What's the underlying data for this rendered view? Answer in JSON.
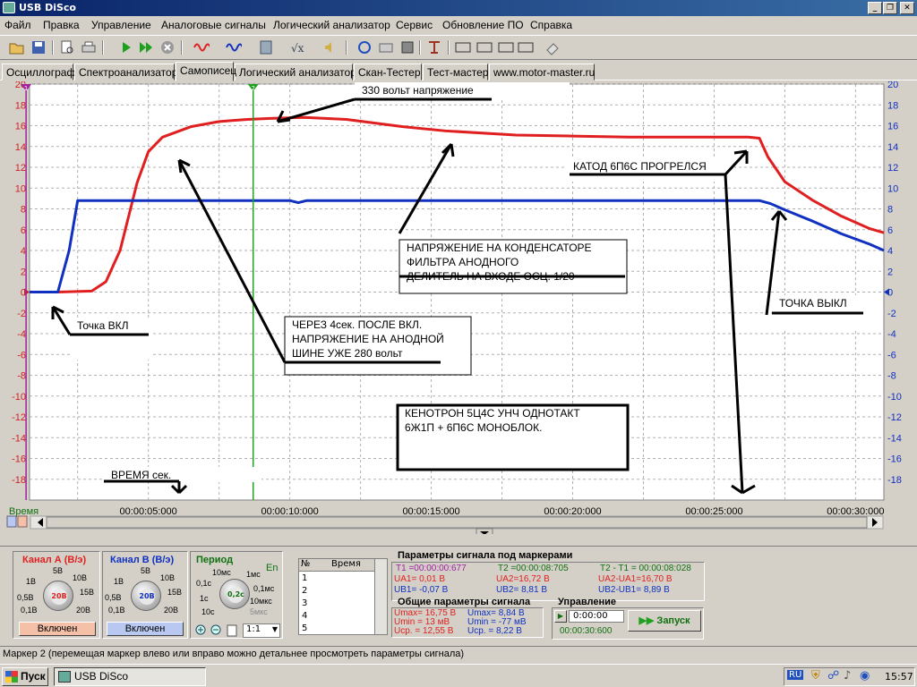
{
  "window": {
    "title": "USB DiSco"
  },
  "menu": [
    "Файл",
    "Правка",
    "Управление",
    "Аналоговые сигналы",
    "Логический анализатор",
    "Сервис",
    "Обновление ПО",
    "Справка"
  ],
  "tabs": [
    "Осциллограф",
    "Спектроанализатор",
    "Самописец",
    "Логический анализатор",
    "Скан-Тестер",
    "Тест-мастер",
    "www.motor-master.ru"
  ],
  "active_tab": "Самописец",
  "chart_data": {
    "type": "line",
    "xlabel": "Время",
    "x_ticks": [
      "00:00:05:000",
      "00:00:10:000",
      "00:00:15:000",
      "00:00:20:000",
      "00:00:25:000",
      "00:00:30:000"
    ],
    "x_tick_seconds": [
      5,
      10,
      15,
      20,
      25,
      30
    ],
    "xlim": [
      0.8,
      31
    ],
    "ylim": [
      -20,
      20
    ],
    "y_ticks": [
      20,
      18,
      16,
      14,
      12,
      10,
      8,
      6,
      4,
      2,
      0,
      -2,
      -4,
      -6,
      -8,
      -10,
      -12,
      -14,
      -16,
      -18
    ],
    "grid": true,
    "series": [
      {
        "color": "#e02020",
        "x": [
          0.8,
          1.8,
          3.0,
          3.5,
          4.0,
          4.6,
          5.0,
          5.5,
          6.5,
          7.5,
          8.5,
          9.3,
          10.5,
          12.0,
          14.0,
          15.5,
          18.0,
          20.0,
          22.0,
          24.0,
          25.0,
          26.2,
          26.6,
          26.9,
          27.5,
          28.5,
          29.5,
          30.5,
          31.0
        ],
        "y": [
          0,
          0,
          0.1,
          1.0,
          4.0,
          10.5,
          13.5,
          14.9,
          15.9,
          16.4,
          16.6,
          16.7,
          16.8,
          16.6,
          15.9,
          15.5,
          15.1,
          15.0,
          14.9,
          14.9,
          14.9,
          14.9,
          14.8,
          13.0,
          10.6,
          8.8,
          7.3,
          6.1,
          5.7
        ]
      },
      {
        "color": "#1030c0",
        "x": [
          0.8,
          1.8,
          2.2,
          2.5,
          10.0,
          10.3,
          10.6,
          11.0,
          20.0,
          25.0,
          26.2,
          26.6,
          27.0,
          27.5,
          28.5,
          29.5,
          30.5,
          31.0
        ],
        "y": [
          0,
          0,
          4.0,
          8.8,
          8.8,
          8.6,
          8.8,
          8.8,
          8.8,
          8.8,
          8.8,
          8.8,
          8.5,
          7.9,
          6.8,
          5.6,
          4.6,
          4.0
        ]
      }
    ],
    "markers": [
      {
        "name": "1",
        "x_seconds": 0.677,
        "color": "#a020a0"
      },
      {
        "name": "2",
        "x_seconds": 8.705,
        "color": "#20a020"
      }
    ],
    "annotations": [
      {
        "id": "a330",
        "lines": [
          "330  вольт  напряжение"
        ]
      },
      {
        "id": "katod",
        "lines": [
          "КАТОД  6П6С  ПРОГРЕЛСЯ"
        ]
      },
      {
        "id": "cond",
        "lines": [
          "НАПРЯЖЕНИЕ  НА  КОНДЕНСАТОРЕ",
          "ФИЛЬТРА  АНОДНОГО",
          "ДЕЛИТЕЛЬ  НА  ВХОДЕ  ОСЦ.  1/20"
        ]
      },
      {
        "id": "on",
        "lines": [
          "Точка  ВКЛ"
        ]
      },
      {
        "id": "cherez",
        "lines": [
          "ЧЕРЕЗ  4сек.  ПОСЛЕ  ВКЛ.",
          "НАПРЯЖЕНИЕ  НА  АНОДНОЙ",
          "ШИНЕ  УЖЕ  280  вольт"
        ]
      },
      {
        "id": "off",
        "lines": [
          "ТОЧКА  ВЫКЛ"
        ]
      },
      {
        "id": "keno",
        "lines": [
          "КЕНОТРОН  5Ц4С  УНЧ  ОДНОТАКТ",
          "6Ж1П + 6П6С  МОНОБЛОК."
        ]
      },
      {
        "id": "vremya",
        "lines": [
          "ВРЕМЯ  сек."
        ]
      }
    ]
  },
  "channel_a": {
    "label": "Канал А (В/э)",
    "knob": "20В",
    "ticks": [
      "5В",
      "10В",
      "1В",
      "15В",
      "0,5В",
      "0,1В",
      "20В"
    ],
    "state": "Включен",
    "color": "#e02020"
  },
  "channel_b": {
    "label": "Канал В (В/э)",
    "knob": "20В",
    "ticks": [
      "5В",
      "10В",
      "1В",
      "15В",
      "0,5В",
      "0,1В",
      "20В"
    ],
    "state": "Включен",
    "color": "#1030c0"
  },
  "period": {
    "label": "Период",
    "en": "En",
    "knob": "0,2с",
    "ticks": [
      "10мс",
      "1мс",
      "0,1с",
      "0,1мс",
      "1с",
      "10мкс",
      "10с",
      "5мкс"
    ],
    "ratio": "1:1"
  },
  "marker_table": {
    "headers": [
      "№",
      "Время"
    ],
    "rows": [
      "1",
      "2",
      "3",
      "4",
      "5"
    ]
  },
  "marker_params": {
    "title": "Параметры сигнала под маркерами",
    "t1": "T1 =00:00:00:677",
    "t2": "T2 =00:00:08:705",
    "dt": "T2 - T1 = 00:00:08:028",
    "ua1": "UA1= 0,01 В",
    "ua2": "UA2=16,72 В",
    "dua": "UA2-UA1=16,70 В",
    "ub1": "UB1= -0,07 В",
    "ub2": "UB2= 8,81 В",
    "dub": "UB2-UB1= 8,89 В"
  },
  "general_params": {
    "title": "Общие параметры сигнала",
    "a": [
      "Umax= 16,75 В",
      "Umin = 13 мВ",
      "Uср. = 12,55 В"
    ],
    "b": [
      "Umax= 8,84 В",
      "Umin = -77 мВ",
      "Uср. = 8,22 В"
    ]
  },
  "control": {
    "title": "Управление",
    "time_value": "0:00:00",
    "elapsed": "00:00:30:600",
    "start_label": "Запуск"
  },
  "status_text": "Маркер 2 (перемещая маркер влево или вправо можно детальнее просмотреть параметры сигнала)",
  "taskbar": {
    "start": "Пуск",
    "app": "USB DiSco",
    "lang": "RU",
    "clock": "15:57"
  }
}
